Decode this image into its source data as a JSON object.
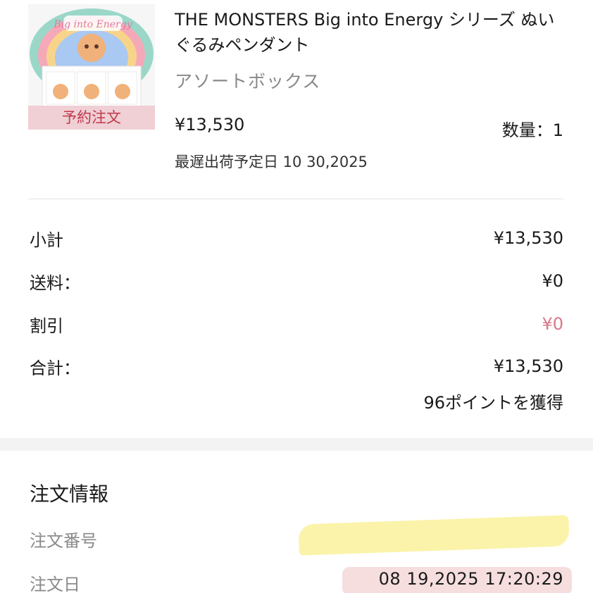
{
  "product": {
    "image_alt": "Big into Energy",
    "badge": "予約注文",
    "title": "THE MONSTERS Big into Energy シリーズ ぬいぐるみペンダント",
    "variant": "アソートボックス",
    "price": "¥13,530",
    "quantity": "数量：1",
    "ship_date": "最遅出荷予定日 10 30,2025"
  },
  "summary": {
    "subtotal_label": "小計",
    "subtotal_value": "¥13,530",
    "shipping_label": "送料：",
    "shipping_value": "¥0",
    "discount_label": "割引",
    "discount_value": "¥0",
    "total_label": "合計：",
    "total_value": "¥13,530",
    "points": "96ポイントを獲得"
  },
  "order_info": {
    "title": "注文情報",
    "number_label": "注文番号",
    "date_label": "注文日",
    "date_value": "08 19,2025 17:20:29"
  },
  "colors": {
    "discount": "#d9788a",
    "badge_bg": "#efcbd1",
    "badge_text": "#c0384b",
    "redaction": "#fbf3a9"
  }
}
